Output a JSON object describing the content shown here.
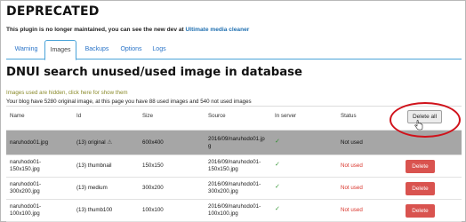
{
  "header": {
    "deprecated_title": "DEPRECATED",
    "notice_text": "This plugin is no longer maintained, you can see the new dev at ",
    "notice_link": "Ultimate media cleaner"
  },
  "tabs": [
    {
      "label": "Warning"
    },
    {
      "label": "Images",
      "active": true
    },
    {
      "label": "Backups"
    },
    {
      "label": "Options"
    },
    {
      "label": "Logs"
    }
  ],
  "main": {
    "page_title": "DNUI search unused/used image in database",
    "hidden_message": "Images used are hidden, click here for show them",
    "summary": "Your blog have 5280 original image, at this page you have 88 used images and 540 not used images"
  },
  "table": {
    "columns": [
      "Name",
      "Id",
      "Size",
      "Source",
      "In server",
      "Status"
    ],
    "delete_all_label": "Delete all",
    "original_row": {
      "name": "naruhodo01.jpg",
      "id": "(13) original",
      "size": "600x400",
      "source_line1": "2016/09/naruhodo01.jp",
      "source_line2": "g",
      "in_server": "✓",
      "status": "Not used"
    },
    "rows": [
      {
        "name_line1": "naruhodo01-",
        "name_line2": "150x150.jpg",
        "id": "(13) thumbnail",
        "size": "150x150",
        "source_line1": "2016/09/naruhodo01-",
        "source_line2": "150x150.jpg",
        "in_server": "✓",
        "status": "Not used",
        "action": "Delete"
      },
      {
        "name_line1": "naruhodo01-",
        "name_line2": "300x200.jpg",
        "id": "(13) medium",
        "size": "300x200",
        "source_line1": "2016/09/naruhodo01-",
        "source_line2": "300x200.jpg",
        "in_server": "✓",
        "status": "Not used",
        "action": "Delete"
      },
      {
        "name_line1": "naruhodo01-",
        "name_line2": "100x100.jpg",
        "id": "(13) thumb100",
        "size": "100x100",
        "source_line1": "2016/09/naruhodo01-",
        "source_line2": "100x100.jpg",
        "in_server": "✓",
        "status": "Not used",
        "action": "Delete"
      }
    ]
  },
  "colors": {
    "link": "#2271b1",
    "tab_border": "#4aa3d8",
    "not_used": "#d9342b",
    "delete_button": "#d9534f",
    "highlight_row": "#a6a6a6",
    "annotation_ring": "#d0121b"
  },
  "icons": {
    "warning": "warning-icon",
    "check": "check-icon",
    "cursor": "hand-cursor-icon"
  }
}
